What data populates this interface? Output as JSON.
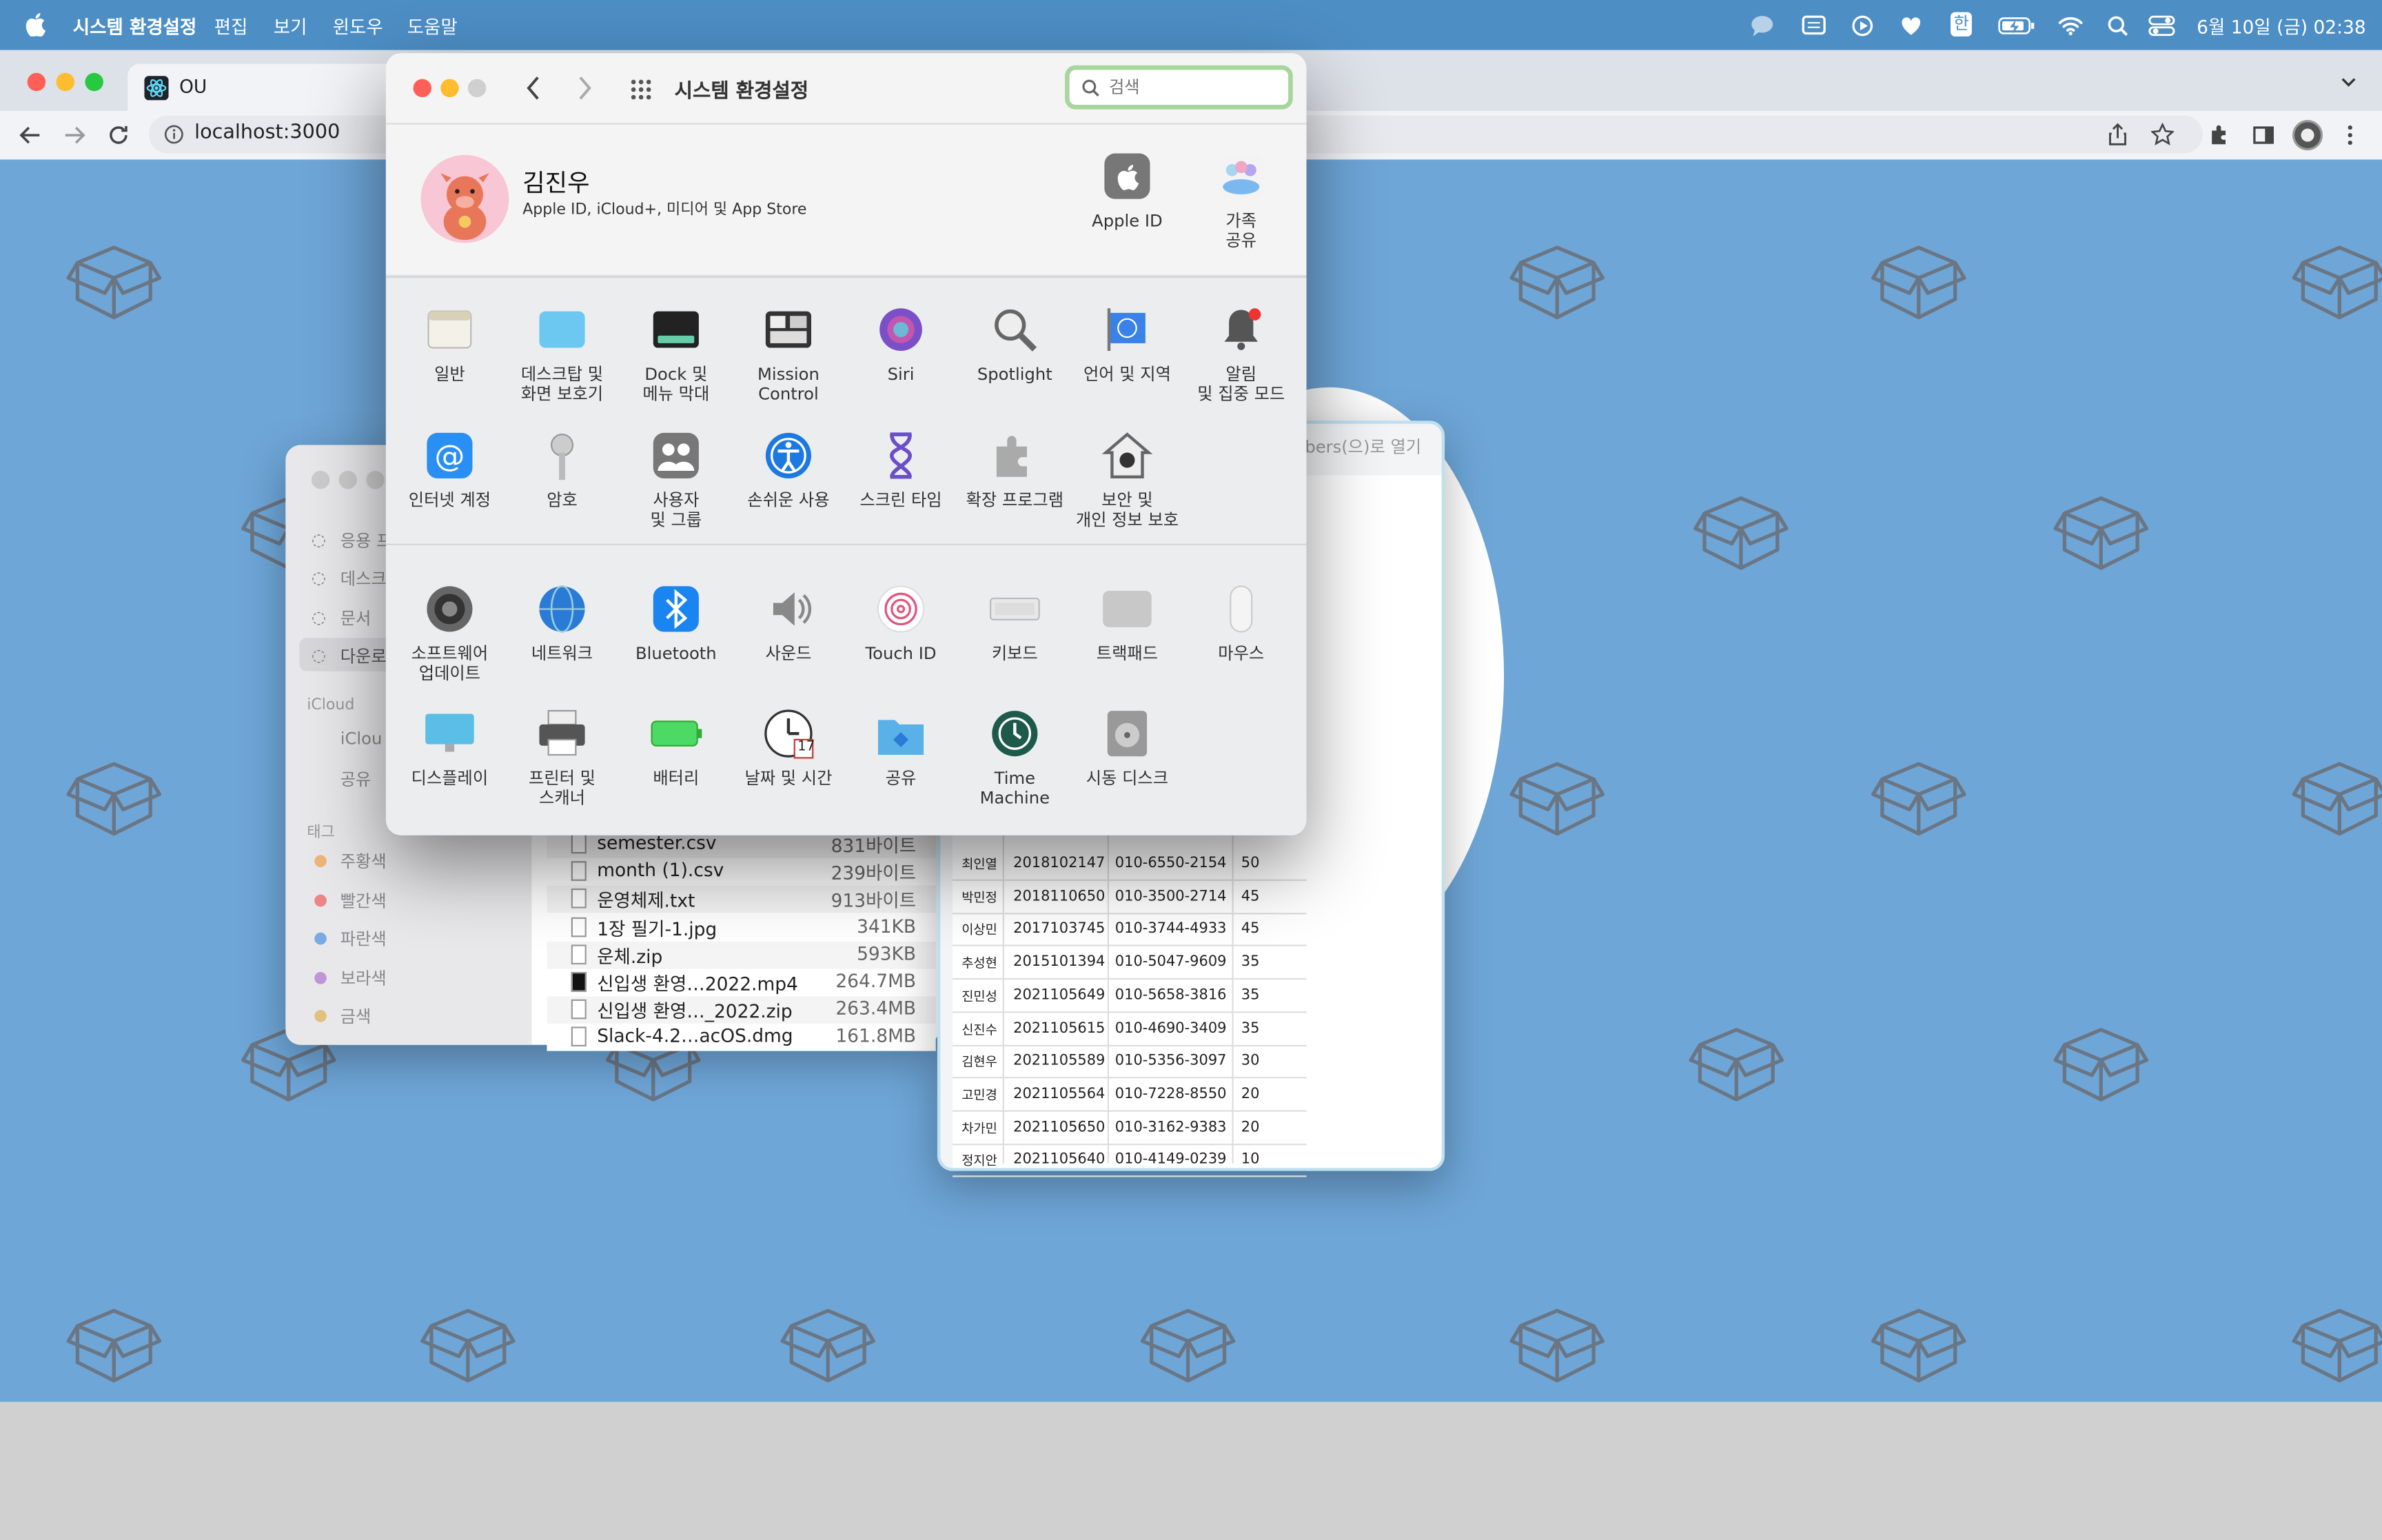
{
  "menubar": {
    "app_name": "시스템 환경설정",
    "menus": [
      "편집",
      "보기",
      "윈도우",
      "도움말"
    ],
    "ime": "한",
    "datetime": "6월 10일 (금) 02:38"
  },
  "browser": {
    "tab_title": "OU",
    "url": "localhost:3000"
  },
  "sysprefs": {
    "title": "시스템 환경설정",
    "search_placeholder": "검색",
    "user": {
      "name": "김진우",
      "subtitle": "Apple ID, iCloud+, 미디어 및 App Store"
    },
    "top_items": [
      {
        "label": "Apple ID",
        "icon": "apple-id-icon"
      },
      {
        "label": "가족\n공유",
        "icon": "family-sharing-icon"
      }
    ],
    "row1": [
      {
        "label": "일반",
        "icon": "general-icon"
      },
      {
        "label": "데스크탑 및\n화면 보호기",
        "icon": "desktop-icon"
      },
      {
        "label": "Dock 및\n메뉴 막대",
        "icon": "dock-icon"
      },
      {
        "label": "Mission\nControl",
        "icon": "mission-control-icon"
      },
      {
        "label": "Siri",
        "icon": "siri-icon"
      },
      {
        "label": "Spotlight",
        "icon": "spotlight-icon"
      },
      {
        "label": "언어 및 지역",
        "icon": "language-icon"
      },
      {
        "label": "알림\n및 집중 모드",
        "icon": "notifications-icon"
      }
    ],
    "row2": [
      {
        "label": "인터넷 계정",
        "icon": "internet-accounts-icon"
      },
      {
        "label": "암호",
        "icon": "passwords-icon"
      },
      {
        "label": "사용자\n및 그룹",
        "icon": "users-groups-icon"
      },
      {
        "label": "손쉬운 사용",
        "icon": "accessibility-icon"
      },
      {
        "label": "스크린 타임",
        "icon": "screen-time-icon"
      },
      {
        "label": "확장 프로그램",
        "icon": "extensions-icon"
      },
      {
        "label": "보안 및\n개인 정보 보호",
        "icon": "security-icon"
      }
    ],
    "row3": [
      {
        "label": "소프트웨어\n업데이트",
        "icon": "software-update-icon"
      },
      {
        "label": "네트워크",
        "icon": "network-icon"
      },
      {
        "label": "Bluetooth",
        "icon": "bluetooth-icon"
      },
      {
        "label": "사운드",
        "icon": "sound-icon"
      },
      {
        "label": "Touch ID",
        "icon": "touch-id-icon"
      },
      {
        "label": "키보드",
        "icon": "keyboard-icon"
      },
      {
        "label": "트랙패드",
        "icon": "trackpad-icon"
      },
      {
        "label": "마우스",
        "icon": "mouse-icon"
      }
    ],
    "row4": [
      {
        "label": "디스플레이",
        "icon": "display-icon"
      },
      {
        "label": "프린터 및\n스캐너",
        "icon": "printer-icon"
      },
      {
        "label": "배터리",
        "icon": "battery-icon"
      },
      {
        "label": "날짜 및 시간",
        "icon": "date-time-icon"
      },
      {
        "label": "공유",
        "icon": "sharing-icon"
      },
      {
        "label": "Time\nMachine",
        "icon": "time-machine-icon"
      },
      {
        "label": "시동 디스크",
        "icon": "startup-disk-icon"
      }
    ],
    "calendar_day": "17"
  },
  "finder": {
    "sidebar": [
      "응용 프",
      "데스크",
      "문서",
      "다운로"
    ],
    "icloud_header": "iCloud",
    "icloud": [
      "iClou",
      "공유"
    ],
    "tags_header": "태그",
    "tags": [
      {
        "label": "주황색",
        "color": "#f0a04b"
      },
      {
        "label": "빨간색",
        "color": "#f05a5a"
      },
      {
        "label": "파란색",
        "color": "#4a90e2"
      },
      {
        "label": "보라색",
        "color": "#b070d0"
      },
      {
        "label": "금색",
        "color": "#e0b050"
      }
    ],
    "files": [
      {
        "name": "semester.csv",
        "size": "831바이트"
      },
      {
        "name": "month (1).csv",
        "size": "239바이트"
      },
      {
        "name": "운영체제.txt",
        "size": "913바이트"
      },
      {
        "name": "1장 필기-1.jpg",
        "size": "341KB"
      },
      {
        "name": "운체.zip",
        "size": "593KB"
      },
      {
        "name": "신입생 환영…2022.mp4",
        "size": "264.7MB"
      },
      {
        "name": "신입생 환영…_2022.zip",
        "size": "263.4MB"
      },
      {
        "name": "Slack-4.2…acOS.dmg",
        "size": "161.8MB"
      }
    ]
  },
  "preview": {
    "open_with": "bers(으)로 열기",
    "rows": [
      {
        "name": "최인열",
        "id": "2018102147",
        "phone": "010-6550-2154",
        "score": "50"
      },
      {
        "name": "박민정",
        "id": "2018110650",
        "phone": "010-3500-2714",
        "score": "45"
      },
      {
        "name": "이상민",
        "id": "2017103745",
        "phone": "010-3744-4933",
        "score": "45"
      },
      {
        "name": "추성현",
        "id": "2015101394",
        "phone": "010-5047-9609",
        "score": "35"
      },
      {
        "name": "진민성",
        "id": "2021105649",
        "phone": "010-5658-3816",
        "score": "35"
      },
      {
        "name": "신진수",
        "id": "2021105615",
        "phone": "010-4690-3409",
        "score": "35"
      },
      {
        "name": "김현우",
        "id": "2021105589",
        "phone": "010-5356-3097",
        "score": "30"
      },
      {
        "name": "고민경",
        "id": "2021105564",
        "phone": "010-7228-8550",
        "score": "20"
      },
      {
        "name": "차가민",
        "id": "2021105650",
        "phone": "010-3162-9383",
        "score": "20"
      },
      {
        "name": "정지안",
        "id": "2021105640",
        "phone": "010-4149-0239",
        "score": "10"
      }
    ]
  }
}
